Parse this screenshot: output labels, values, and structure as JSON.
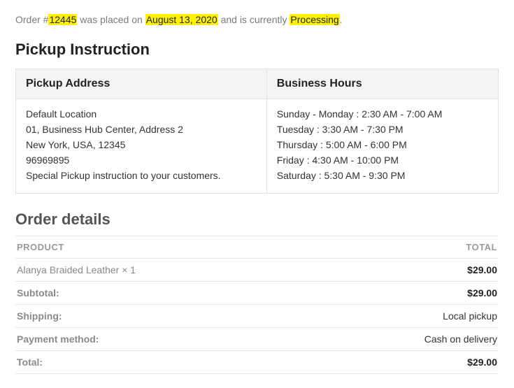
{
  "order_status": {
    "prefix": "Order #",
    "number": "12445",
    "mid1": " was placed on ",
    "date": "August 13, 2020",
    "mid2": " and is currently ",
    "status": "Processing",
    "suffix": "."
  },
  "pickup": {
    "heading": "Pickup Instruction",
    "address_header": "Pickup Address",
    "hours_header": "Business Hours",
    "address_lines": [
      "Default Location",
      "01, Business Hub Center, Address 2",
      "New York, USA, 12345",
      "96969895",
      "Special Pickup instruction to your customers."
    ],
    "hours_lines": [
      "Sunday - Monday : 2:30 AM - 7:00 AM",
      "Tuesday : 3:30 AM - 7:30 PM",
      "Thursday : 5:00 AM - 6:00 PM",
      "Friday : 4:30 AM - 10:00 PM",
      "Saturday : 5:30 AM - 9:30 PM"
    ]
  },
  "details": {
    "heading": "Order details",
    "col_product": "PRODUCT",
    "col_total": "TOTAL",
    "line_items": [
      {
        "name": "Alanya Braided Leather × 1",
        "total": "$29.00"
      }
    ],
    "totals": [
      {
        "label": "Subtotal:",
        "value": "$29.00",
        "strong": true
      },
      {
        "label": "Shipping:",
        "value": "Local pickup",
        "strong": false
      },
      {
        "label": "Payment method:",
        "value": "Cash on delivery",
        "strong": false
      },
      {
        "label": "Total:",
        "value": "$29.00",
        "strong": true
      }
    ]
  }
}
